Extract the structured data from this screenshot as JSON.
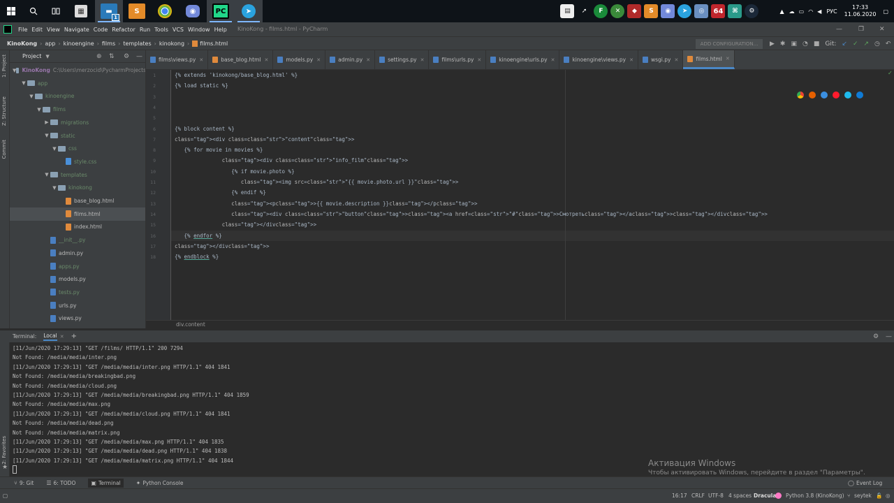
{
  "taskbar": {
    "clock_time": "17:33",
    "clock_date": "11.06.2020",
    "lang": "РУС",
    "badge_count": "1",
    "tray_64": "64"
  },
  "menu": {
    "items": [
      "File",
      "Edit",
      "View",
      "Navigate",
      "Code",
      "Refactor",
      "Run",
      "Tools",
      "VCS",
      "Window",
      "Help"
    ],
    "window_title": "KinoKong - films.html - PyCharm"
  },
  "navbar": {
    "crumbs": [
      "KinoKong",
      "app",
      "kinoengine",
      "films",
      "templates",
      "kinokong",
      "films.html"
    ],
    "add_config": "ADD CONFIGURATION...",
    "git_label": "Git:"
  },
  "project": {
    "title": "Project",
    "rows": [
      {
        "label": "KinoKong",
        "extra": "C:\\Users\\merzocid\\PycharmProjects",
        "type": "folder",
        "arrow": "▼",
        "indent": 0,
        "color": "#9876aa"
      },
      {
        "label": "app",
        "type": "folder",
        "arrow": "▼",
        "indent": 1,
        "color": "#6a8a6a"
      },
      {
        "label": "kinoengine",
        "type": "folder",
        "arrow": "▼",
        "indent": 2,
        "color": "#6a8a6a"
      },
      {
        "label": "films",
        "type": "folder",
        "arrow": "▼",
        "indent": 3,
        "color": "#6a8a6a"
      },
      {
        "label": "migrations",
        "type": "folder",
        "arrow": "▶",
        "indent": 4,
        "color": "#6a8a6a"
      },
      {
        "label": "static",
        "type": "folder",
        "arrow": "▼",
        "indent": 4,
        "color": "#6a8a6a"
      },
      {
        "label": "css",
        "type": "folder",
        "arrow": "▼",
        "indent": 5,
        "color": "#6a8a6a"
      },
      {
        "label": "style.css",
        "type": "file",
        "indent": 6,
        "color": "#6a8a6a",
        "icon": "#4a90d9"
      },
      {
        "label": "templates",
        "type": "folder",
        "arrow": "▼",
        "indent": 4,
        "color": "#6a8a6a"
      },
      {
        "label": "kinokong",
        "type": "folder",
        "arrow": "▼",
        "indent": 5,
        "color": "#6a8a6a"
      },
      {
        "label": "base_blog.html",
        "type": "file",
        "indent": 6,
        "color": "#bbbbbb",
        "icon": "#e08a3c"
      },
      {
        "label": "films.html",
        "type": "file",
        "indent": 6,
        "color": "#bbbbbb",
        "icon": "#e08a3c",
        "selected": true
      },
      {
        "label": "index.html",
        "type": "file",
        "indent": 6,
        "color": "#bbbbbb",
        "icon": "#e08a3c"
      },
      {
        "label": "__init__.py",
        "type": "file",
        "indent": 4,
        "color": "#6a8a6a",
        "icon": "#4a7fc1"
      },
      {
        "label": "admin.py",
        "type": "file",
        "indent": 4,
        "color": "#bbbbbb",
        "icon": "#4a7fc1"
      },
      {
        "label": "apps.py",
        "type": "file",
        "indent": 4,
        "color": "#6a8a6a",
        "icon": "#4a7fc1"
      },
      {
        "label": "models.py",
        "type": "file",
        "indent": 4,
        "color": "#bbbbbb",
        "icon": "#4a7fc1"
      },
      {
        "label": "tests.py",
        "type": "file",
        "indent": 4,
        "color": "#6a8a6a",
        "icon": "#4a7fc1"
      },
      {
        "label": "urls.py",
        "type": "file",
        "indent": 4,
        "color": "#bbbbbb",
        "icon": "#4a7fc1"
      },
      {
        "label": "views.py",
        "type": "file",
        "indent": 4,
        "color": "#bbbbbb",
        "icon": "#4a7fc1"
      }
    ]
  },
  "tabs": [
    {
      "label": "films\\views.py",
      "icon": "#4a7fc1"
    },
    {
      "label": "base_blog.html",
      "icon": "#e08a3c"
    },
    {
      "label": "models.py",
      "icon": "#4a7fc1"
    },
    {
      "label": "admin.py",
      "icon": "#4a7fc1"
    },
    {
      "label": "settings.py",
      "icon": "#4a7fc1"
    },
    {
      "label": "films\\urls.py",
      "icon": "#4a7fc1"
    },
    {
      "label": "kinoengine\\urls.py",
      "icon": "#4a7fc1"
    },
    {
      "label": "kinoengine\\views.py",
      "icon": "#4a7fc1"
    },
    {
      "label": "wsgi.py",
      "icon": "#4a7fc1"
    },
    {
      "label": "films.html",
      "icon": "#e08a3c",
      "active": true
    }
  ],
  "code": [
    "{% extends 'kinokong/base_blog.html' %}",
    "{% load static %}",
    "",
    "",
    "",
    "{% block content %}",
    "<div class=\"content\">",
    "   {% for movie in movies %}",
    "               <div class=\"info_film\">",
    "                  {% if movie.photo %}",
    "                     <img src=\"{{ movie.photo.url }}\">",
    "                  {% endif %}",
    "                  <p>{{ movie.description }}</p>",
    "                  <div class=\"button\"><a href=\"#\">Смотреть</a></div>",
    "               </div>",
    "   {% endfor %}",
    "</div>",
    "{% endblock %}"
  ],
  "editor_breadcrumb": "div.content",
  "terminal": {
    "label": "Terminal:",
    "tab": "Local",
    "lines": [
      "[11/Jun/2020 17:29:13] \"GET /films/ HTTP/1.1\" 200 7294",
      "Not Found: /media/media/inter.png",
      "[11/Jun/2020 17:29:13] \"GET /media/media/inter.png HTTP/1.1\" 404 1841",
      "Not Found: /media/media/breakingbad.png",
      "Not Found: /media/media/cloud.png",
      "[11/Jun/2020 17:29:13] \"GET /media/media/breakingbad.png HTTP/1.1\" 404 1859",
      "Not Found: /media/media/max.png",
      "[11/Jun/2020 17:29:13] \"GET /media/media/cloud.png HTTP/1.1\" 404 1841",
      "Not Found: /media/media/dead.png",
      "Not Found: /media/media/matrix.png",
      "[11/Jun/2020 17:29:13] \"GET /media/media/max.png HTTP/1.1\" 404 1835",
      "[11/Jun/2020 17:29:13] \"GET /media/media/dead.png HTTP/1.1\" 404 1838",
      "[11/Jun/2020 17:29:13] \"GET /media/media/matrix.png HTTP/1.1\" 404 1844"
    ]
  },
  "activation": {
    "title": "Активация Windows",
    "subtitle": "Чтобы активировать Windows, перейдите в раздел \"Параметры\"."
  },
  "toolwindows": {
    "git": "9: Git",
    "todo": "6: TODO",
    "terminal": "Terminal",
    "python_console": "Python Console",
    "event_log": "Event Log"
  },
  "sidebar_tabs": {
    "project": "1: Project",
    "structure": "Z: Structure",
    "commit": "Commit",
    "favorites": "2: Favorites"
  },
  "status": {
    "position": "16:17",
    "line_sep": "CRLF",
    "encoding": "UTF-8",
    "indent": "4 spaces",
    "theme": "Dracula",
    "interpreter": "Python 3.8 (KinoKong)",
    "branch": "seytek"
  }
}
